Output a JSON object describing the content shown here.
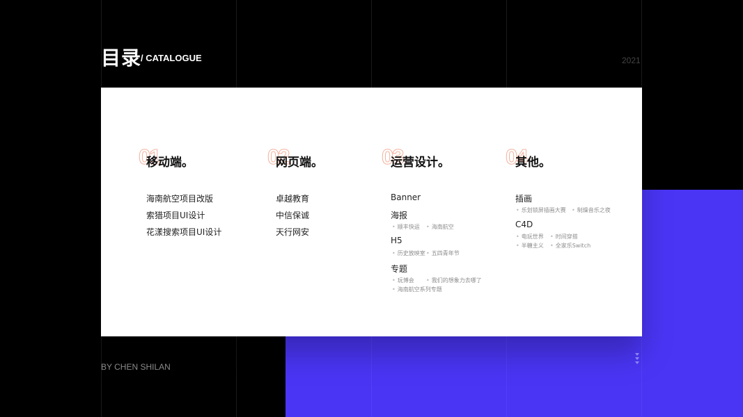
{
  "header": {
    "title": "目录",
    "subtitle": "/ CATALOGUE",
    "year": "2021"
  },
  "footer": {
    "author": "BY CHEN SHILAN"
  },
  "sections": [
    {
      "number": "01",
      "title": "移动端。",
      "items": [
        "海南航空项目改版",
        "索猎项目UI设计",
        "花漾搜索项目UI设计"
      ]
    },
    {
      "number": "02",
      "title": "网页端。",
      "items": [
        "卓越教育",
        "中信保诚",
        "天行网安"
      ]
    },
    {
      "number": "03",
      "title": "运营设计。",
      "groups": [
        {
          "label": "Banner",
          "subs": []
        },
        {
          "label": "海报",
          "subs": [
            "顺丰快运",
            "海南航空"
          ]
        },
        {
          "label": "H5",
          "subs": [
            "历史放映室",
            "五四青年节"
          ]
        },
        {
          "label": "专题",
          "subs": [
            "玩博会",
            "我们的想象力去哪了",
            "海南航空系列专题"
          ]
        }
      ]
    },
    {
      "number": "04",
      "title": "其他。",
      "groups": [
        {
          "label": "插画",
          "subs": [
            "乐划锁屏插画大赛",
            "制燥音乐之夜"
          ]
        },
        {
          "label": "C4D",
          "subs": [
            "电玩世界",
            "时间穿搭",
            "半糖主义",
            "全家乐Switch"
          ]
        }
      ]
    }
  ],
  "colors": {
    "accent_blue": "#4a35f5",
    "number_outline": "#f3b29d",
    "background": "#000000"
  }
}
